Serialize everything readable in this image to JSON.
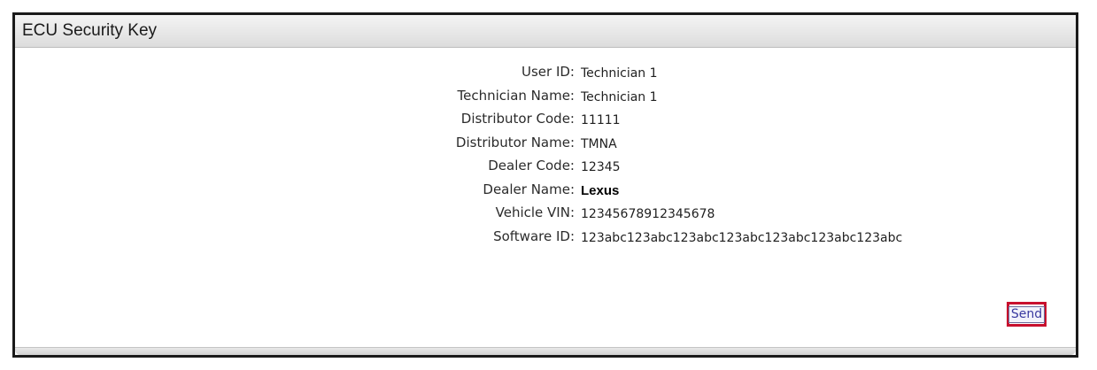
{
  "dialog": {
    "title": "ECU Security Key"
  },
  "fields": [
    {
      "label": "User ID:",
      "value": "Technician 1"
    },
    {
      "label": "Technician Name:",
      "value": "Technician 1"
    },
    {
      "label": "Distributor Code:",
      "value": "11111"
    },
    {
      "label": "Distributor Name:",
      "value": "TMNA"
    },
    {
      "label": "Dealer Code:",
      "value": "12345"
    },
    {
      "label": "Dealer Name:",
      "value": "Lexus"
    },
    {
      "label": "Vehicle VIN:",
      "value": "12345678912345678"
    },
    {
      "label": "Software ID:",
      "value": "123abc123abc123abc123abc123abc123abc123abc"
    }
  ],
  "actions": {
    "send_label": "Send"
  },
  "colors": {
    "highlight": "#c8102e",
    "titlebar": "#e6e6e6",
    "border": "#1a1a1a"
  }
}
